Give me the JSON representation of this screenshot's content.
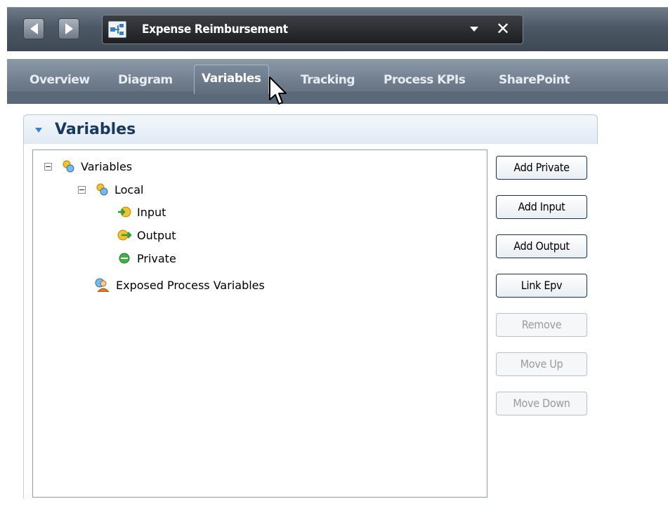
{
  "editor": {
    "document_title": "Expense Reimbursement",
    "tabs": [
      {
        "label": "Overview"
      },
      {
        "label": "Diagram"
      },
      {
        "label": "Variables"
      },
      {
        "label": "Tracking"
      },
      {
        "label": "Process KPIs"
      },
      {
        "label": "SharePoint"
      }
    ]
  },
  "section": {
    "title": "Variables"
  },
  "tree": {
    "items": [
      {
        "label": "Variables"
      },
      {
        "label": "Local"
      },
      {
        "label": "Input"
      },
      {
        "label": "Output"
      },
      {
        "label": "Private"
      },
      {
        "label": "Exposed Process Variables"
      }
    ]
  },
  "buttons": {
    "add_private": "Add Private",
    "add_input": "Add Input",
    "add_output": "Add Output",
    "link_epv": "Link Epv",
    "remove": "Remove",
    "move_up": "Move Up",
    "move_down": "Move Down"
  },
  "colors": {
    "accent": "#3b7fd1",
    "header_dark": "#4c5865",
    "disabled_text": "#9a9a9a"
  },
  "icons": {
    "nav_back": "left-triangle",
    "nav_forward": "right-triangle",
    "document": "process-diagram-icon",
    "close": "x",
    "dropdown": "down-triangle",
    "collapse": "down-triangle",
    "variables": "variables-icon",
    "input": "input-arrow-icon",
    "output": "output-arrow-icon",
    "private": "green-circle-icon",
    "exposed": "user-group-icon"
  }
}
